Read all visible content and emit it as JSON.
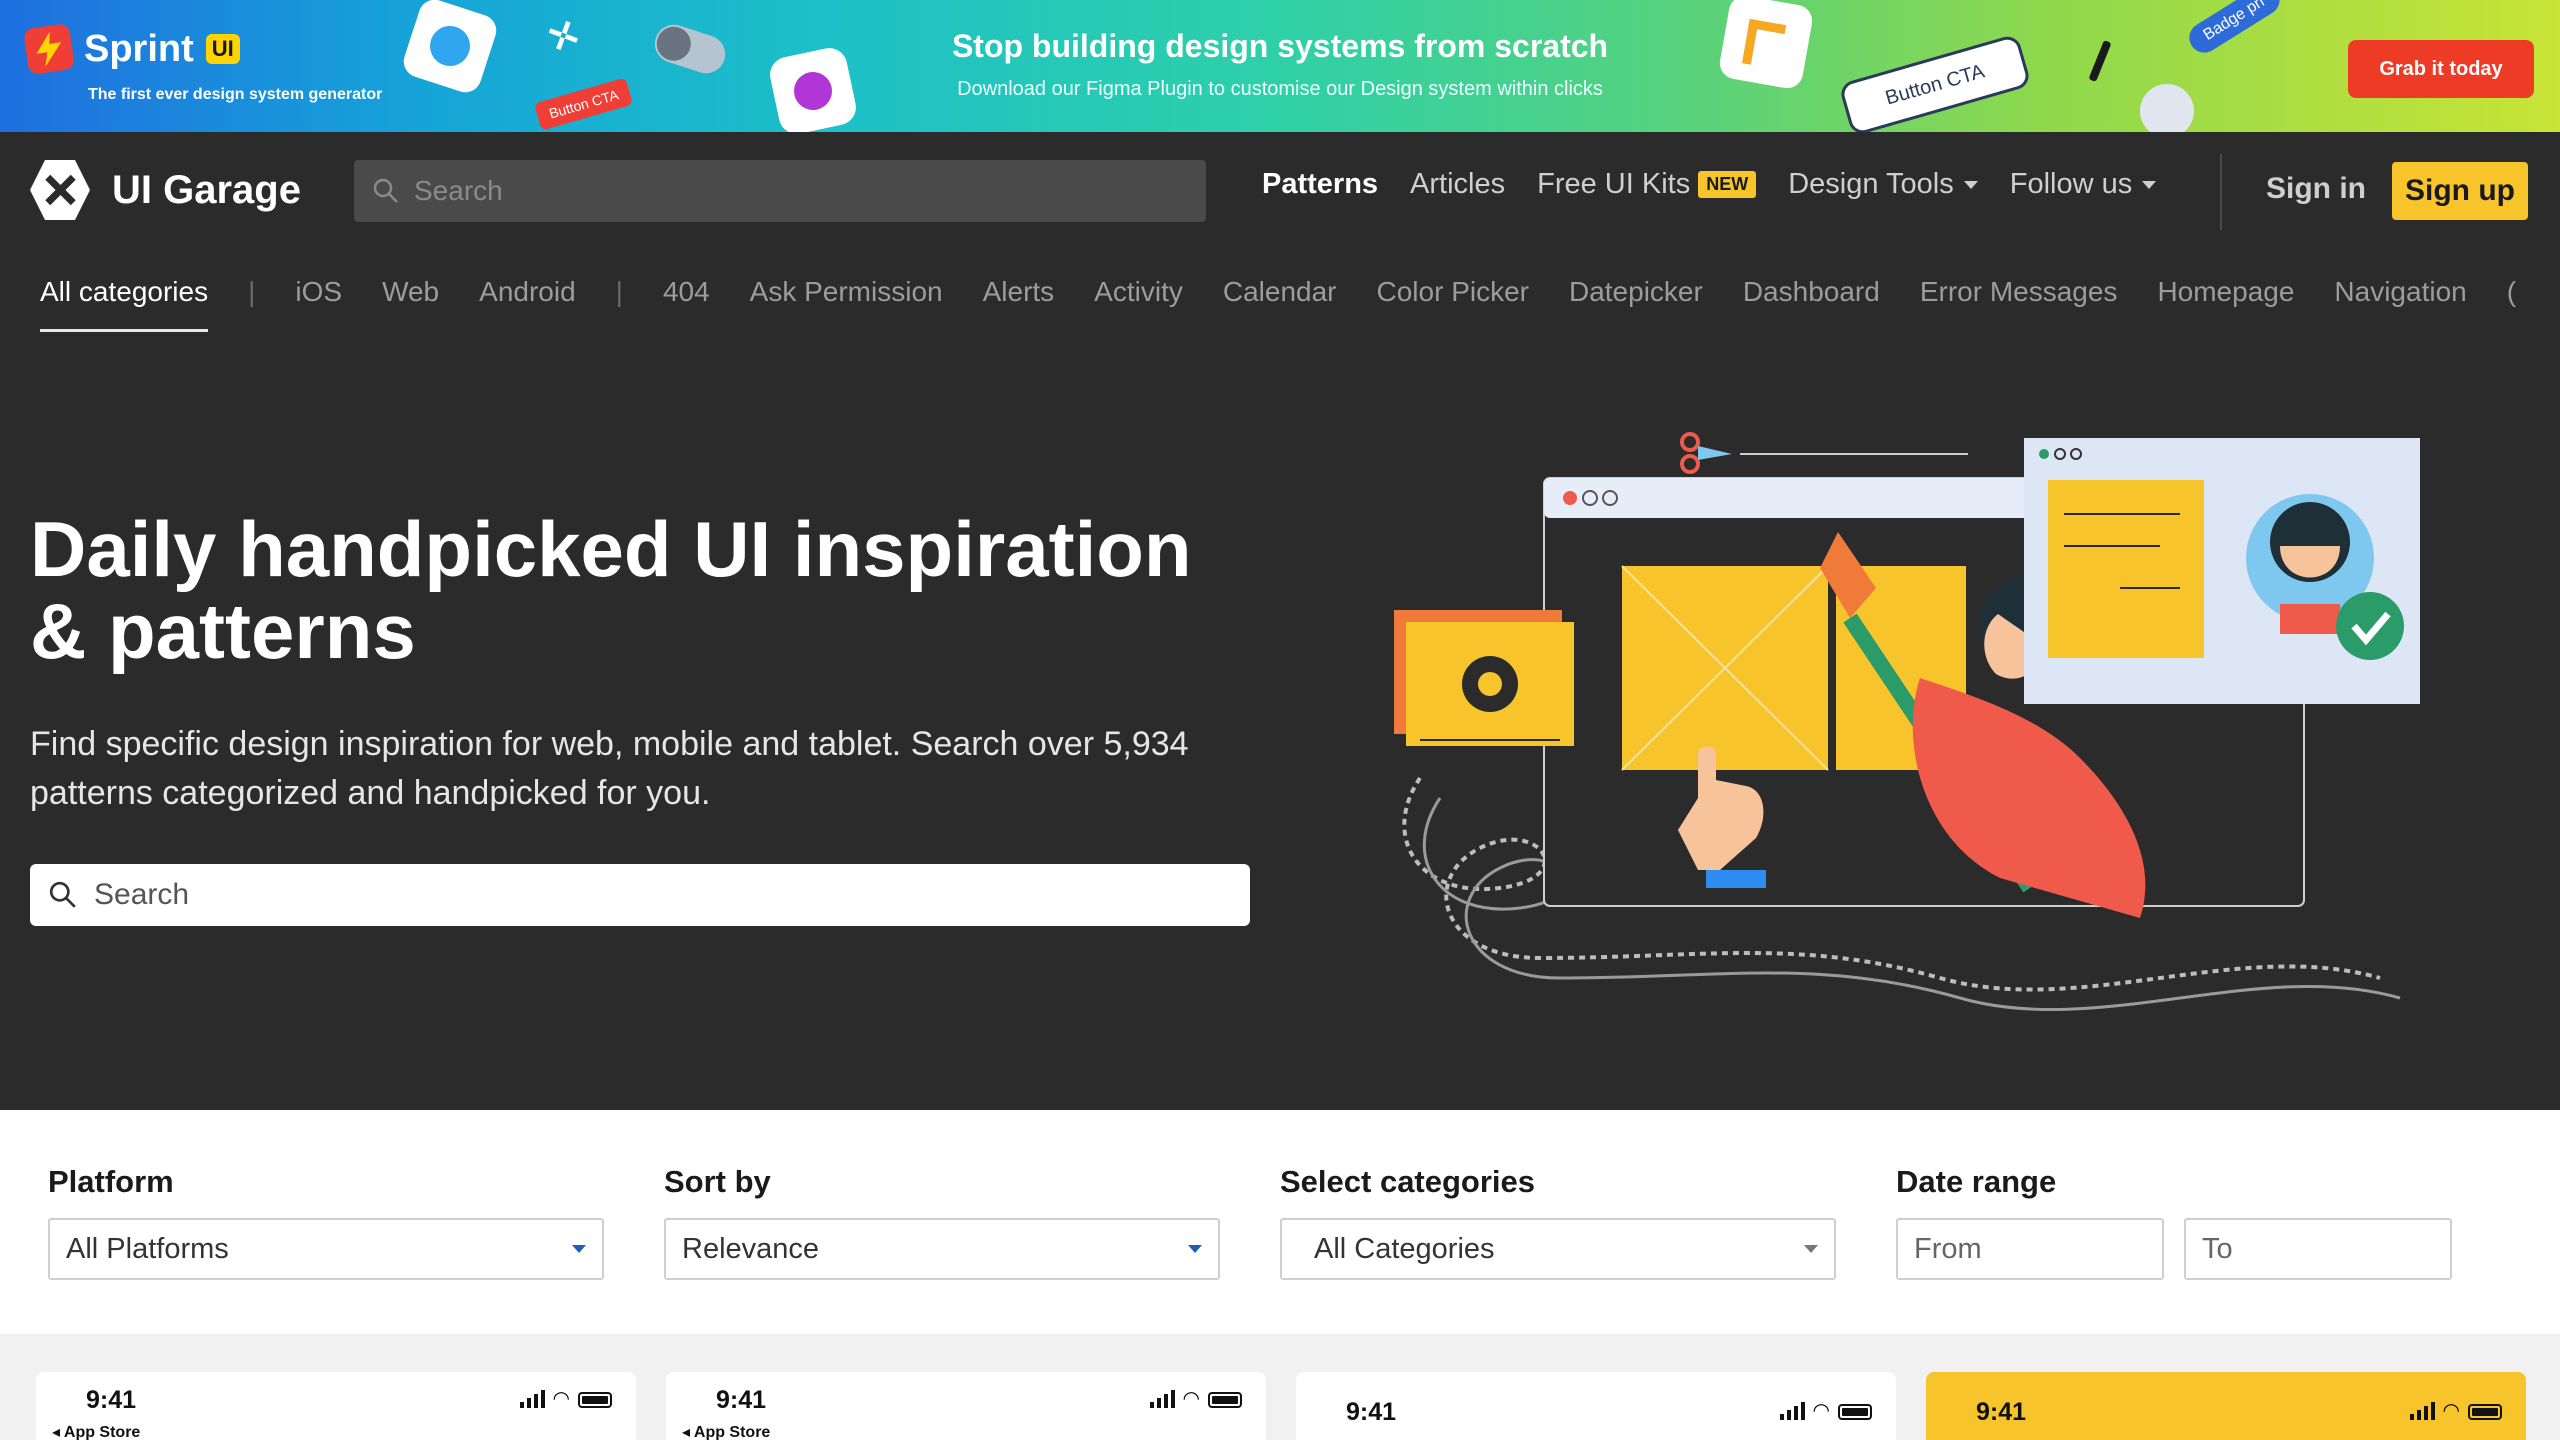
{
  "banner": {
    "brand": "Sprint",
    "brand_badge": "UI",
    "tagline": "The first ever design system generator",
    "title": "Stop building design systems from scratch",
    "subtitle": "Download our Figma Plugin to customise our Design system within clicks",
    "cta": "Grab it today",
    "deco_button_red": "Button CTA",
    "deco_button_white": "Button CTA",
    "deco_badge": "Badge pri"
  },
  "header": {
    "logo_text": "UI Garage",
    "search_placeholder": "Search",
    "nav": [
      {
        "label": "Patterns"
      },
      {
        "label": "Articles"
      },
      {
        "label": "Free UI Kits",
        "badge": "NEW"
      },
      {
        "label": "Design Tools"
      },
      {
        "label": "Follow us"
      }
    ],
    "signin": "Sign in",
    "signup": "Sign up"
  },
  "categories": [
    "All categories",
    "iOS",
    "Web",
    "Android",
    "404",
    "Ask Permission",
    "Alerts",
    "Activity",
    "Calendar",
    "Color Picker",
    "Datepicker",
    "Dashboard",
    "Error Messages",
    "Homepage",
    "Navigation",
    "("
  ],
  "hero": {
    "title_line1": "Daily handpicked UI inspiration",
    "title_line2": "& patterns",
    "desc_line1": "Find specific design inspiration for web, mobile and tablet. Search over 5,934",
    "desc_line2": "patterns categorized and handpicked for you.",
    "search_placeholder": "Search"
  },
  "filters": {
    "platform": {
      "label": "Platform",
      "value": "All Platforms"
    },
    "sort": {
      "label": "Sort by",
      "value": "Relevance"
    },
    "categories": {
      "label": "Select categories",
      "value": "All Categories"
    },
    "date": {
      "label": "Date range",
      "from": "From",
      "to": "To"
    }
  },
  "cards": [
    {
      "time": "9:41",
      "back": "◂ App Store"
    },
    {
      "time": "9:41",
      "back": "◂ App Store"
    },
    {
      "time": "9:41",
      "back": ""
    },
    {
      "time": "9:41",
      "back": ""
    }
  ],
  "colors": {
    "accent_yellow": "#f7c52b",
    "banner_cta": "#ee3b26",
    "dark_bg": "#2b2b2b"
  }
}
